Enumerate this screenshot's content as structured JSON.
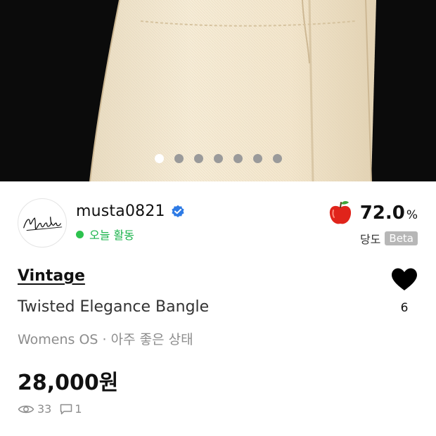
{
  "gallery": {
    "slide_count": 7,
    "active_index": 0
  },
  "seller": {
    "avatar_text": "Musta",
    "name": "musta0821",
    "verified_icon": "verified-check-icon",
    "status": "오늘 활동",
    "status_color": "#19b34a"
  },
  "rating": {
    "icon": "apple-icon",
    "value": "72.0",
    "unit": "%",
    "label": "당도",
    "badge": "Beta"
  },
  "product": {
    "category": "Vintage",
    "title": "Twisted Elegance Bangle",
    "meta": "Womens OS · 아주 좋은 상태",
    "price": "28,000원"
  },
  "likes": {
    "icon": "heart-icon",
    "count": "6"
  },
  "stats": {
    "views_icon": "eye-icon",
    "views": "33",
    "comments_icon": "comment-icon",
    "comments": "1"
  }
}
